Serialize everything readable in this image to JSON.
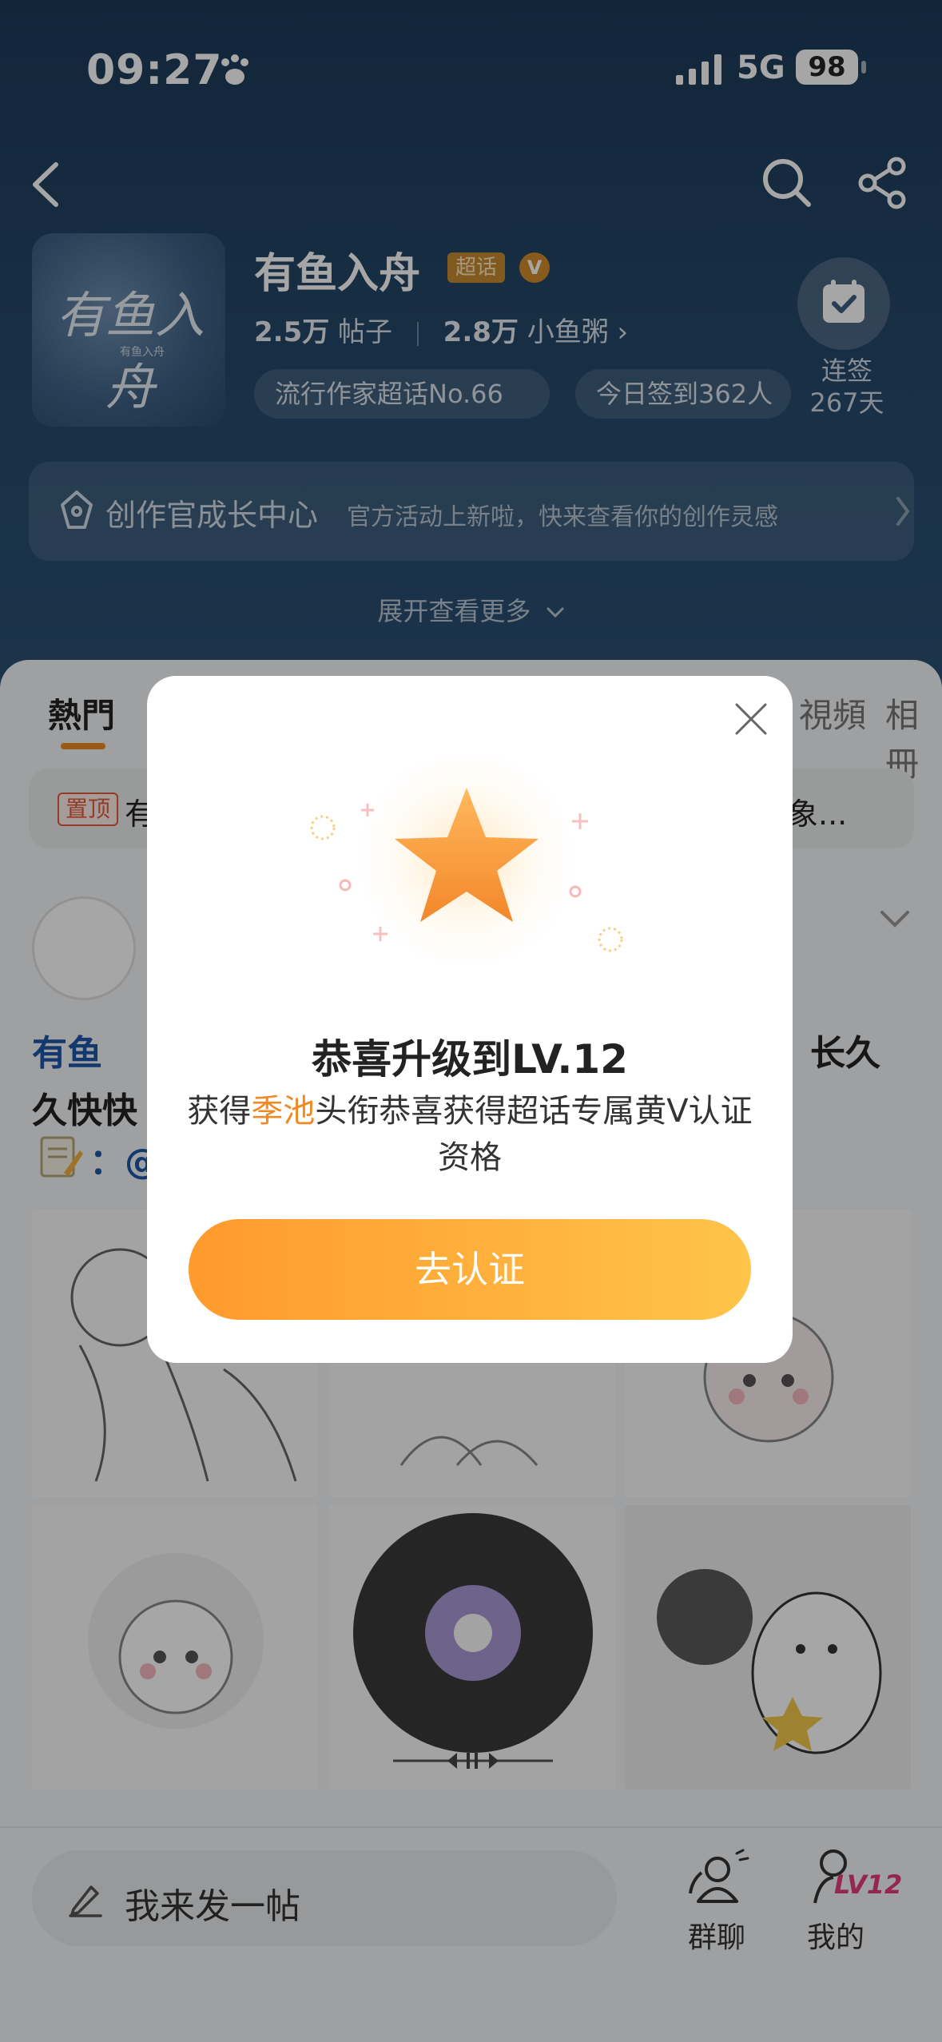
{
  "status_bar": {
    "time": "09:27",
    "network": "5G",
    "battery": "98"
  },
  "topic": {
    "title": "有鱼入舟",
    "badge": "超话",
    "verified": "V",
    "avatar_text": "有鱼入舟",
    "avatar_sub": "有鱼入舟",
    "posts_count": "2.5万",
    "posts_label": "帖子",
    "fans_count": "2.8万",
    "fans_label": "小鱼粥",
    "rank_pill": "流行作家超话No.66",
    "checkin_pill": "今日签到362人",
    "signin_label": "连签",
    "signin_days": "267天"
  },
  "growth": {
    "title": "创作官成长中心",
    "desc": "官方活动上新啦，快来查看你的创作灵感"
  },
  "expand_label": "展开查看更多",
  "tabs": [
    {
      "label": "熱門"
    },
    {
      "label": "視頻"
    },
    {
      "label": "相冊"
    }
  ],
  "pinned": {
    "badge": "置顶",
    "text_left": "有",
    "text_right": "象..."
  },
  "post": {
    "title_line1_left": "有鱼",
    "title_line1_right": "长久",
    "title_line2": "久快快",
    "mention": "：@"
  },
  "bottom": {
    "compose_placeholder": "我来发一帖",
    "group_label": "群聊",
    "me_label": "我的",
    "level_tag": "LV12"
  },
  "modal": {
    "title": "恭喜升级到LV.12",
    "desc_prefix": "获得",
    "desc_highlight": "季池",
    "desc_suffix": "头衔恭喜获得超话专属黄V认证资格",
    "cta": "去认证"
  },
  "colors": {
    "accent": "#f08a24",
    "cover": "#274a6c",
    "link": "#1e56a8",
    "level": "#e33b7a"
  }
}
